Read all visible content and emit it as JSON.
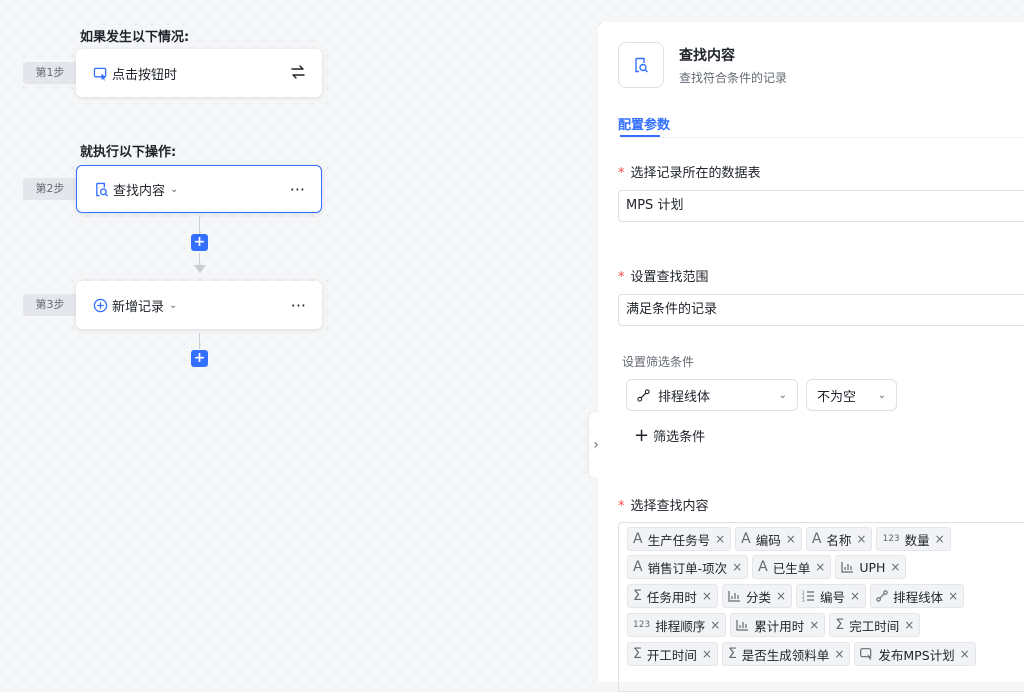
{
  "workflow": {
    "trigger_heading": "如果发生以下情况:",
    "action_heading": "就执行以下操作:",
    "steps": [
      {
        "tag": "第1步",
        "label": "点击按钮时",
        "icon": "cursor-click-icon",
        "right_icon": "swap-icon"
      },
      {
        "tag": "第2步",
        "label": "查找内容",
        "icon": "find-record-icon",
        "menu": "···"
      },
      {
        "tag": "第3步",
        "label": "新增记录",
        "icon": "plus-circle-icon",
        "menu": "···"
      }
    ],
    "add_step": "+"
  },
  "panel": {
    "title": "查找内容",
    "subtitle": "查找符合条件的记录",
    "tab": "配置参数",
    "table_label": "选择记录所在的数据表",
    "table_value": "MPS 计划",
    "scope_label": "设置查找范围",
    "scope_value": "满足条件的记录",
    "filter_label": "设置筛选条件",
    "filter_field": "排程线体",
    "filter_operator": "不为空",
    "add_filter": "筛选条件",
    "content_label": "选择查找内容",
    "required_mark": "*"
  },
  "tags": [
    [
      {
        "t": "A",
        "label": "生产任务号"
      },
      {
        "t": "A",
        "label": "编码"
      },
      {
        "t": "A",
        "label": "名称"
      },
      {
        "t": "123",
        "label": "数量"
      }
    ],
    [
      {
        "t": "A",
        "label": "销售订单-项次"
      },
      {
        "t": "A",
        "label": "已生单"
      },
      {
        "t": "chart",
        "label": "UPH"
      }
    ],
    [
      {
        "t": "sum",
        "label": "任务用时"
      },
      {
        "t": "chart",
        "label": "分类"
      },
      {
        "t": "list",
        "label": "编号"
      },
      {
        "t": "link",
        "label": "排程线体"
      }
    ],
    [
      {
        "t": "123",
        "label": "排程顺序"
      },
      {
        "t": "chart",
        "label": "累计用时"
      },
      {
        "t": "sum",
        "label": "完工时间"
      }
    ],
    [
      {
        "t": "sum",
        "label": "开工时间"
      },
      {
        "t": "sum",
        "label": "是否生成领料单"
      },
      {
        "t": "btn",
        "label": "发布MPS计划"
      }
    ]
  ]
}
